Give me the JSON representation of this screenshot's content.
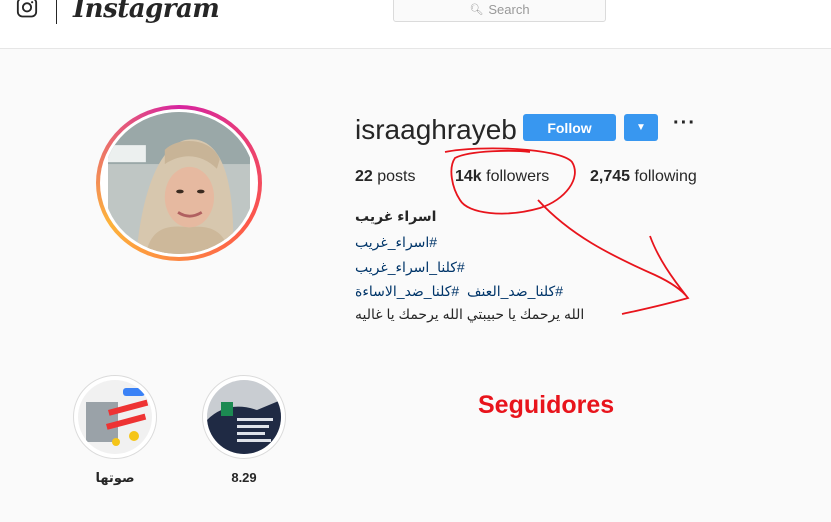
{
  "header": {
    "brand": "Instagram",
    "search_placeholder": "Search",
    "icons": {
      "logo": "instagram-camera-icon",
      "search": "magnifier-icon"
    }
  },
  "profile": {
    "username": "israaghrayeb",
    "follow_label": "Follow",
    "dropdown_icon": "caret-down-icon",
    "more_label": "···",
    "stats": {
      "posts_count": "22",
      "posts_label": "posts",
      "followers_count": "14k",
      "followers_label": "followers",
      "following_count": "2,745",
      "following_label": "following"
    },
    "bio": {
      "name": "اسراء غريب",
      "tag1": "#اسراء_غريب",
      "tag2": "#كلنا_اسراء_غريب",
      "tag3a": "#كلنا_ضد_العنف",
      "tag3b": "#كلنا_ضد_الاساءة",
      "line5": "الله يرحمك يا حبيبتي الله يرحمك يا غاليه"
    }
  },
  "highlights": [
    {
      "label": "صوتها"
    },
    {
      "label": "8.29"
    }
  ],
  "annotation": {
    "text": "Seguidores",
    "color": "#e8141c"
  },
  "colors": {
    "accent": "#3897f0",
    "link": "#003569"
  }
}
